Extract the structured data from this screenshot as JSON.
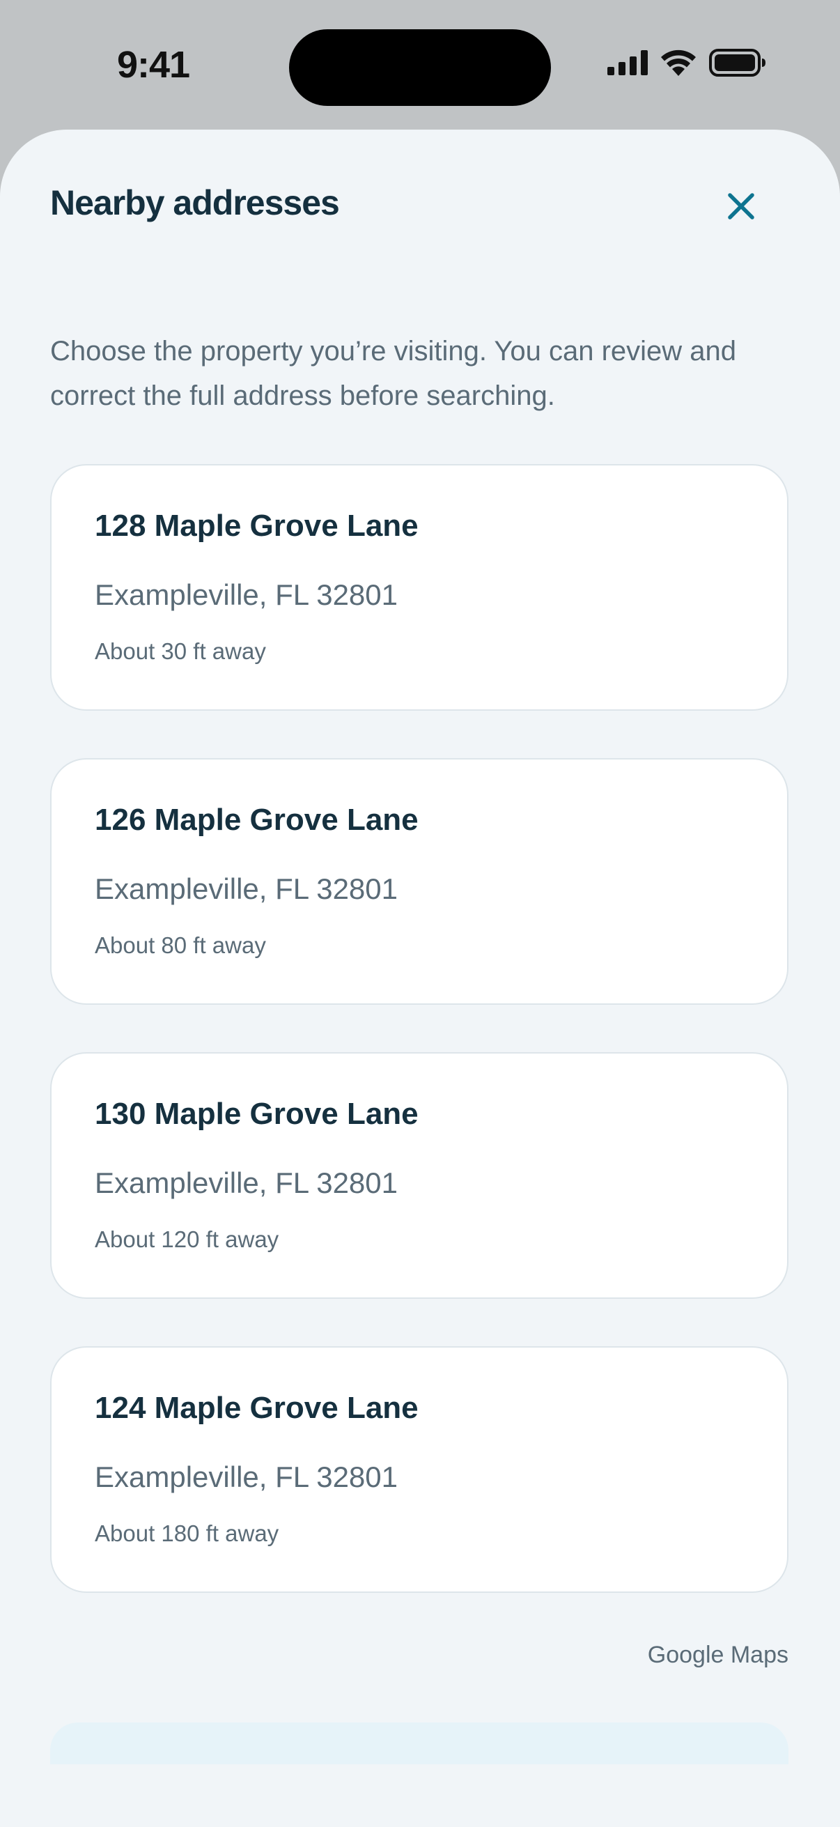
{
  "status_bar": {
    "time": "9:41"
  },
  "sheet": {
    "title": "Nearby addresses",
    "intro": "Choose the property you’re visiting. You can review and correct the full address before searching.",
    "close_icon": "close-icon",
    "accent_color": "#0e7490"
  },
  "addresses": [
    {
      "street": "128 Maple Grove Lane",
      "city": "Exampleville, FL 32801",
      "distance": "About 30 ft away"
    },
    {
      "street": "126 Maple Grove Lane",
      "city": "Exampleville, FL 32801",
      "distance": "About 80 ft away"
    },
    {
      "street": "130 Maple Grove Lane",
      "city": "Exampleville, FL 32801",
      "distance": "About 120 ft away"
    },
    {
      "street": "124 Maple Grove Lane",
      "city": "Exampleville, FL 32801",
      "distance": "About 180 ft away"
    }
  ],
  "attribution": "Google Maps"
}
